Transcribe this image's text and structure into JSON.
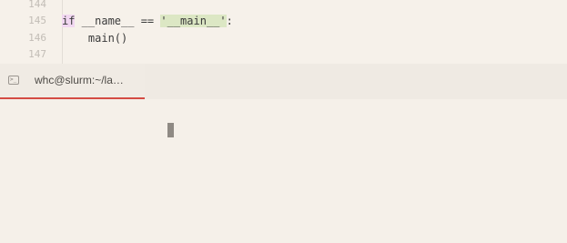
{
  "editor": {
    "lines": [
      {
        "number": "144",
        "code": ""
      },
      {
        "number": "145",
        "keyword": "if",
        "before_string": " __name__ == ",
        "string": "'__main__'",
        "after_string": ":"
      },
      {
        "number": "146",
        "code": "    main()"
      },
      {
        "number": "147",
        "code": ""
      }
    ]
  },
  "terminal": {
    "tab_label": "whc@slurm:~/la…",
    "tab_icon": "terminal-icon",
    "tab_icon_glyph": ">_",
    "accent_color": "#d44b43"
  }
}
